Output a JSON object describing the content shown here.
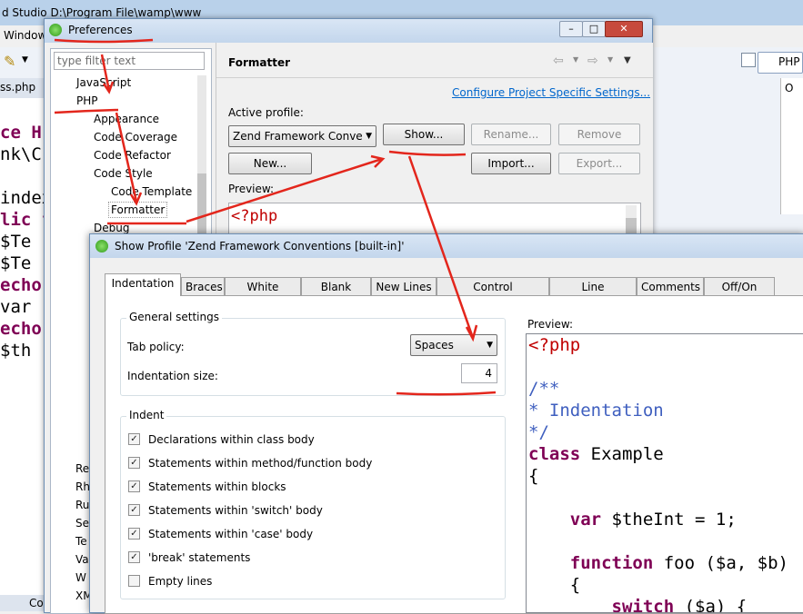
{
  "background": {
    "title": "d Studio D:\\Program File\\wamp\\www",
    "menu_window": "Window",
    "editor_tab": "ss.php",
    "editor_lines": [
      "ce H",
      "nk\\C",
      "",
      "index",
      "lic f",
      " $Te",
      " $Te",
      " echo",
      " var",
      " echo",
      " $th"
    ],
    "right_tab": "PHP",
    "bottom_tab": "Co",
    "side_labels": [
      "Re",
      "Rh",
      "Ru",
      "Se",
      "Te",
      "Va",
      "W",
      "XM"
    ]
  },
  "preferences": {
    "title": "Preferences",
    "filter_placeholder": "type filter text",
    "tree": [
      {
        "label": "JavaScript",
        "level": 1
      },
      {
        "label": "PHP",
        "level": 1
      },
      {
        "label": "Appearance",
        "level": 2
      },
      {
        "label": "Code Coverage",
        "level": 2
      },
      {
        "label": "Code Refactor",
        "level": 2
      },
      {
        "label": "Code Style",
        "level": 2
      },
      {
        "label": "Code Template",
        "level": 3
      },
      {
        "label": "Formatter",
        "level": 3,
        "selected": true
      },
      {
        "label": "Debug",
        "level": 2
      }
    ],
    "page_title": "Formatter",
    "configure_link": "Configure Project Specific Settings...",
    "active_profile_label": "Active profile:",
    "profile_value": "Zend Framework Conve",
    "buttons": {
      "show": "Show...",
      "rename": "Rename...",
      "remove": "Remove",
      "new": "New...",
      "import": "Import...",
      "export": "Export..."
    },
    "preview_label": "Preview:",
    "preview_code": "<?php"
  },
  "show_profile": {
    "title": "Show Profile 'Zend Framework Conventions [built-in]'",
    "tabs": [
      "Indentation",
      "Braces",
      "White Space",
      "Blank Lines",
      "New Lines",
      "Control Statements",
      "Line Wrapping",
      "Comments",
      "Off/On tags"
    ],
    "general_settings": {
      "label": "General settings",
      "tab_policy_label": "Tab policy:",
      "tab_policy_value": "Spaces",
      "indentation_size_label": "Indentation size:",
      "indentation_size_value": "4"
    },
    "indent": {
      "label": "Indent",
      "options": [
        {
          "label": "Declarations within class body",
          "checked": true
        },
        {
          "label": "Statements within method/function body",
          "checked": true
        },
        {
          "label": "Statements within blocks",
          "checked": true
        },
        {
          "label": "Statements within 'switch' body",
          "checked": true
        },
        {
          "label": "Statements within 'case' body",
          "checked": true
        },
        {
          "label": "'break' statements",
          "checked": true
        },
        {
          "label": "Empty lines",
          "checked": false
        }
      ]
    },
    "preview_label": "Preview:",
    "preview_lines": [
      "<?php",
      "",
      "/**",
      "* Indentation",
      "*/",
      "class Example",
      "{",
      "",
      "    var $theInt = 1;",
      "",
      "    function foo ($a, $b)",
      "    {",
      "        switch ($a) {"
    ]
  }
}
